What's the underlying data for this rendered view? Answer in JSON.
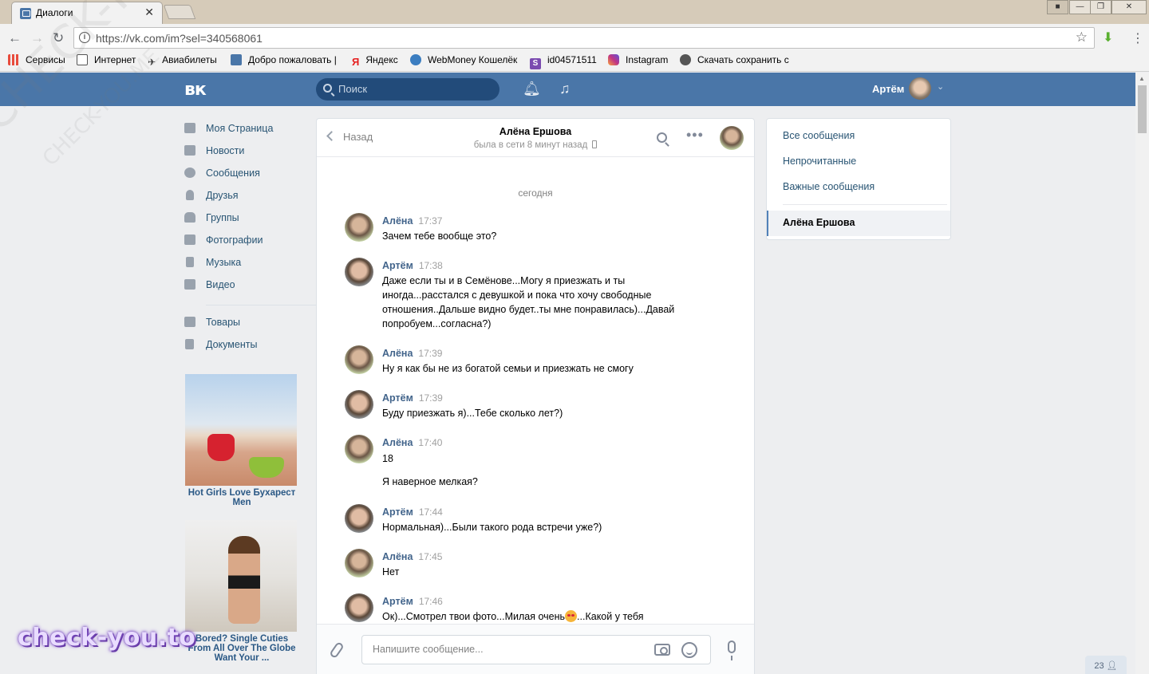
{
  "browser": {
    "tab_title": "Диалоги",
    "tab_close": "✕",
    "url": "https://vk.com/im?sel=340568061",
    "bookmarks": [
      {
        "label": "Сервисы",
        "icon": "apps-grid-icon"
      },
      {
        "label": "Интернет",
        "icon": "document-icon"
      },
      {
        "label": "Авиабилеты",
        "icon": "airplane-icon"
      },
      {
        "label": "Добро пожаловать |",
        "icon": "vk-icon"
      },
      {
        "label": "Яндекс",
        "icon": "yandex-icon"
      },
      {
        "label": "WebMoney Кошелёк",
        "icon": "webmoney-icon"
      },
      {
        "label": "id04571511",
        "icon": "s-icon"
      },
      {
        "label": "Instagram",
        "icon": "instagram-icon"
      },
      {
        "label": "Скачать сохранить с",
        "icon": "eye-icon"
      }
    ]
  },
  "vk_header": {
    "logo": "вк",
    "search_placeholder": "Поиск",
    "user_name": "Артём"
  },
  "left_menu": {
    "items": [
      {
        "label": "Моя Страница",
        "icon": "home-icon"
      },
      {
        "label": "Новости",
        "icon": "news-icon"
      },
      {
        "label": "Сообщения",
        "icon": "messages-icon"
      },
      {
        "label": "Друзья",
        "icon": "friends-icon"
      },
      {
        "label": "Группы",
        "icon": "groups-icon"
      },
      {
        "label": "Фотографии",
        "icon": "camera-icon"
      },
      {
        "label": "Музыка",
        "icon": "music-icon"
      },
      {
        "label": "Видео",
        "icon": "video-icon"
      },
      {
        "label": "Товары",
        "icon": "bag-icon"
      },
      {
        "label": "Документы",
        "icon": "document-icon"
      }
    ]
  },
  "ads": [
    {
      "caption": "Hot Girls Love Бухарест Men"
    },
    {
      "caption": "Bored? Single Cuties From All Over The Globe Want Your ..."
    }
  ],
  "chat": {
    "back_label": "Назад",
    "peer_name": "Алёна Ершова",
    "peer_status": "была в сети 8 минут назад",
    "day_label": "сегодня",
    "messages": [
      {
        "author": "Алёна",
        "time": "17:37",
        "text": "Зачем тебе вообще это?"
      },
      {
        "author": "Артём",
        "time": "17:38",
        "text": "Даже если ты и в Семёнове...Могу я приезжать и ты иногда...расстался с девушкой и пока что хочу свободные отношения..Дальше видно будет..ты мне понравилась)...Давай попробуем...согласна?)"
      },
      {
        "author": "Алёна",
        "time": "17:39",
        "text": "Ну я как бы не из богатой семьи и приезжать не смогу"
      },
      {
        "author": "Артём",
        "time": "17:39",
        "text": "Буду приезжать я)...Тебе сколько лет?)"
      },
      {
        "author": "Алёна",
        "time": "17:40",
        "text": "18",
        "text2": "Я наверное мелкая?"
      },
      {
        "author": "Артём",
        "time": "17:44",
        "text": "Нормальная)...Были такого рода встречи уже?)"
      },
      {
        "author": "Алёна",
        "time": "17:45",
        "text": "Нет"
      },
      {
        "author": "Артём",
        "time": "17:46",
        "text": "Ок)...Смотрел твои фото...Милая очень",
        "text_after_emoji": "...Какой у тебя"
      }
    ],
    "composer_placeholder": "Напишите сообщение..."
  },
  "right_panel": {
    "items": [
      "Все сообщения",
      "Непрочитанные",
      "Важные сообщения"
    ],
    "active_dialog": "Алёна Ершова"
  },
  "online_counter": "23",
  "watermark": {
    "big": "check-you.to",
    "diag": "CHECK-YOU.ME"
  }
}
